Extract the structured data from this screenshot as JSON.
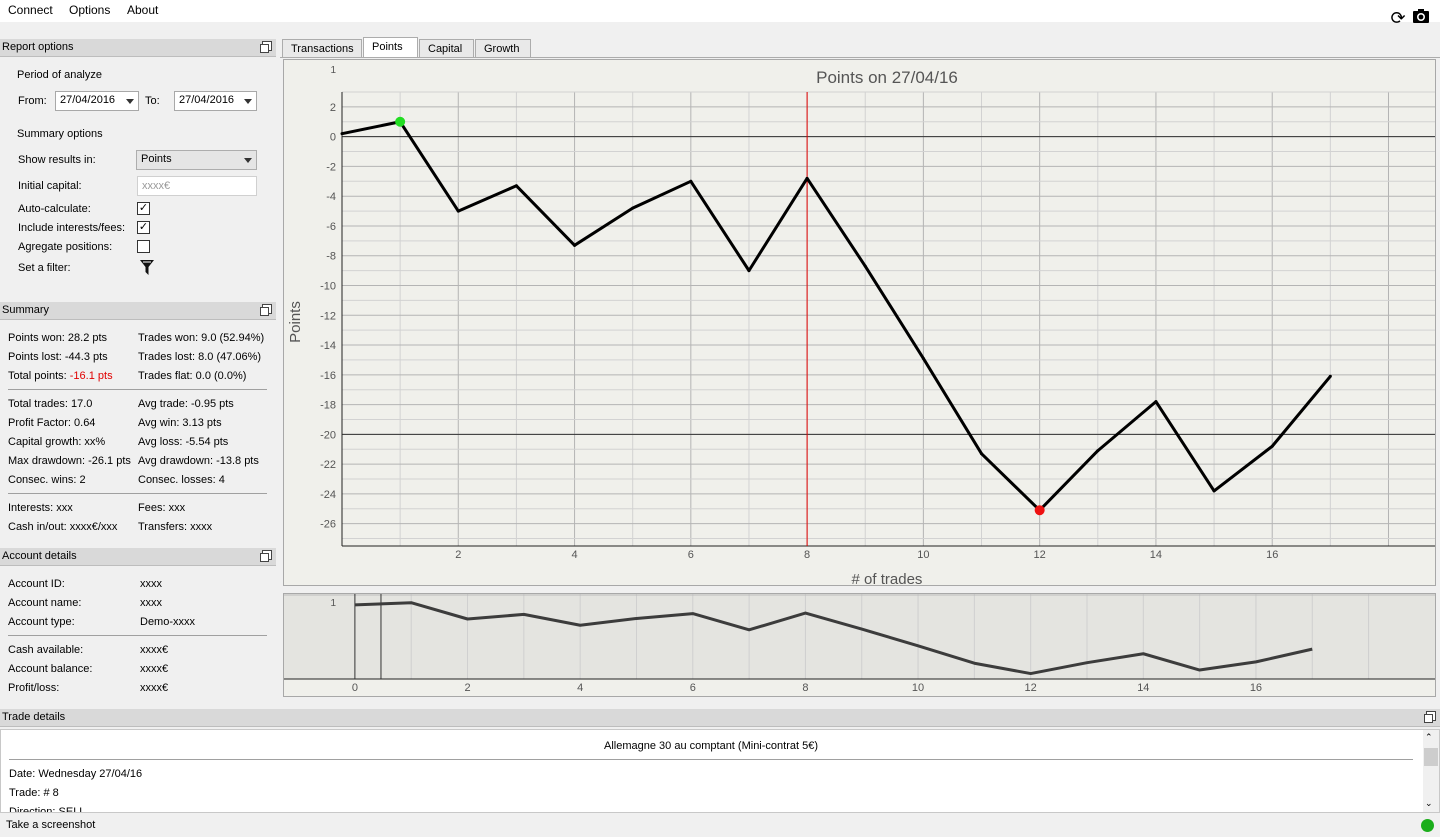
{
  "menu": {
    "connect": "Connect",
    "options": "Options",
    "about": "About"
  },
  "toolbar": {
    "refresh_icon": "refresh-icon",
    "camera_icon": "camera-icon"
  },
  "report_options": {
    "title": "Report options",
    "period_label": "Period of analyze",
    "from_label": "From:",
    "from_value": "27/04/2016",
    "to_label": "To:",
    "to_value": "27/04/2016",
    "summary_options_label": "Summary options",
    "show_results_label": "Show results in:",
    "show_results_value": "Points",
    "initial_capital_label": "Initial capital:",
    "initial_capital_placeholder": "xxxx€",
    "auto_calc_label": "Auto-calculate:",
    "auto_calc_checked": true,
    "include_fees_label": "Include interests/fees:",
    "include_fees_checked": true,
    "aggregate_label": "Agregate positions:",
    "aggregate_checked": false,
    "filter_label": "Set a filter:"
  },
  "summary": {
    "title": "Summary",
    "points_won": "Points won: 28.2 pts",
    "trades_won": "Trades won: 9.0 (52.94%)",
    "points_lost": "Points lost: -44.3 pts",
    "trades_lost": "Trades lost: 8.0 (47.06%)",
    "total_points_label": "Total points:",
    "total_points_value": "-16.1 pts",
    "trades_flat": "Trades flat: 0.0 (0.0%)",
    "total_trades": "Total trades: 17.0",
    "avg_trade": "Avg trade: -0.95 pts",
    "profit_factor": "Profit Factor: 0.64",
    "avg_win": "Avg win: 3.13 pts",
    "capital_growth": "Capital growth: xx%",
    "avg_loss": "Avg loss: -5.54 pts",
    "max_drawdown": "Max drawdown: -26.1 pts",
    "avg_drawdown": "Avg drawdown: -13.8 pts",
    "consec_wins": "Consec. wins: 2",
    "consec_losses": "Consec. losses: 4",
    "interests": "Interests: xxx",
    "fees": "Fees: xxx",
    "cash_inout": "Cash in/out: xxxx€/xxx",
    "transfers": "Transfers: xxxx"
  },
  "account": {
    "title": "Account details",
    "id_label": "Account ID:",
    "id_value": "xxxx",
    "name_label": "Account name:",
    "name_value": "xxxx",
    "type_label": "Account type:",
    "type_value": "Demo-xxxx",
    "cash_label": "Cash available:",
    "cash_value": "xxxx€",
    "balance_label": "Account balance:",
    "balance_value": "xxxx€",
    "pl_label": "Profit/loss:",
    "pl_value": "xxxx€"
  },
  "tabs": [
    "Transactions",
    "Points",
    "Capital",
    "Growth"
  ],
  "active_tab": "Points",
  "trade_details": {
    "title": "Trade details",
    "instrument": "Allemagne 30 au comptant (Mini-contrat 5€)",
    "date": "Date: Wednesday 27/04/16",
    "trade": "Trade: # 8",
    "direction": "Direction: SELL"
  },
  "status": {
    "text": "Take a screenshot",
    "indicator_color": "#1cae1c"
  },
  "colors": {
    "line": "#000000",
    "max_marker": "#22dd22",
    "min_marker": "#ee1111",
    "cursor_line": "#e00000",
    "overview_line": "#3c3c3c"
  },
  "chart_data": {
    "type": "line",
    "title": "Points on 27/04/16",
    "xlabel": "# of trades",
    "ylabel": "Points",
    "x": [
      0,
      1,
      2,
      3,
      4,
      5,
      6,
      7,
      8,
      9,
      10,
      11,
      12,
      13,
      14,
      15,
      16,
      17
    ],
    "y": [
      0.2,
      1.0,
      -5.0,
      -3.3,
      -7.3,
      -4.8,
      -3.0,
      -9.0,
      -2.8,
      -8.7,
      -14.9,
      -21.3,
      -25.1,
      -21.1,
      -17.8,
      -23.8,
      -20.8,
      -16.1
    ],
    "xlim": [
      0,
      18.8
    ],
    "ylim": [
      -27.5,
      3
    ],
    "xticks": [
      2,
      4,
      6,
      8,
      10,
      12,
      14,
      16
    ],
    "yticks": [
      2,
      0,
      -2,
      -4,
      -6,
      -8,
      -10,
      -12,
      -14,
      -16,
      -18,
      -20,
      -22,
      -24,
      -26
    ],
    "top_tick": "1",
    "cursor_x": 8,
    "max_point": {
      "x": 1,
      "y": 1.0
    },
    "min_point": {
      "x": 12,
      "y": -25.1
    },
    "overview": {
      "xticks": [
        0,
        2,
        4,
        6,
        8,
        10,
        12,
        14,
        16
      ],
      "top_tick": "1",
      "xlim": [
        -0.3,
        18.7
      ],
      "selection": [
        0,
        0.25
      ]
    }
  }
}
